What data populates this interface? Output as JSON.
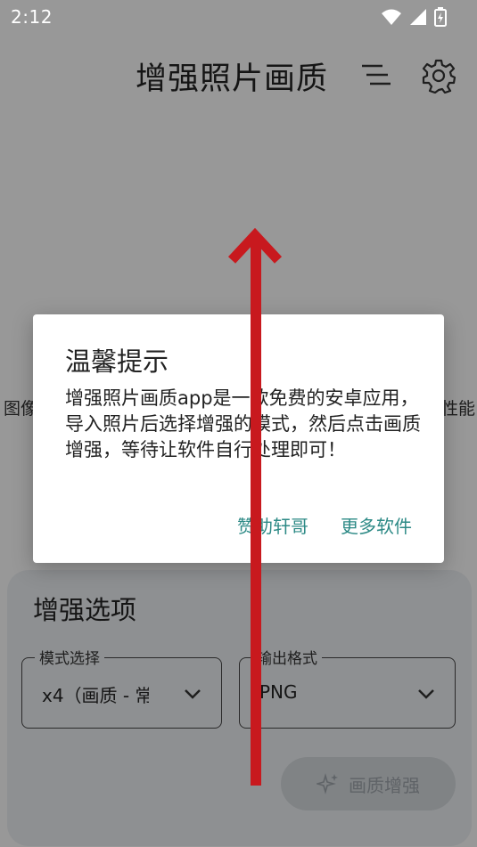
{
  "status_bar": {
    "time": "2:12"
  },
  "header": {
    "title": "增强照片画质"
  },
  "background": {
    "left_text": "图像",
    "right_text": "性能"
  },
  "options_card": {
    "title": "增强选项",
    "mode_field": {
      "label": "模式选择",
      "value": "x4（画质 - 常"
    },
    "format_field": {
      "label": "输出格式",
      "value": "PNG"
    },
    "enhance_button": "画质增强"
  },
  "dialog": {
    "title": "温馨提示",
    "message": "增强照片画质app是一款免费的安卓应用，导入照片后选择增强的模式，然后点击画质增强，等待让软件自行处理即可！",
    "buttons": [
      "赞助轩哥",
      "更多软件"
    ]
  },
  "colors": {
    "accent": "#2d8a86",
    "annotation_arrow": "#c8191e"
  }
}
